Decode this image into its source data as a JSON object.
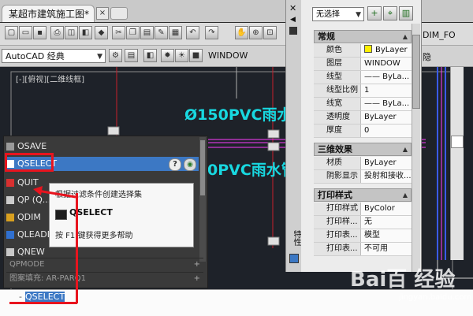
{
  "file_tab": {
    "title": "某超市建筑施工图*",
    "close": "×"
  },
  "toolbar": {
    "dim_style": "DIM_FO",
    "nav_hide": "隐"
  },
  "workspace": {
    "label": "AutoCAD 经典",
    "layer": "WINDOW"
  },
  "viewport": {
    "label": "[-][俯视][二维线框]"
  },
  "drawing_text": {
    "line1": "Ø150PVC雨水管",
    "line2": "0PVC雨水管"
  },
  "palette": {
    "selection": "无选择",
    "side_title": "特性",
    "sections": [
      {
        "title": "常规",
        "rows": [
          {
            "key": "颜色",
            "value": "ByLayer",
            "swatch": "#ffef00"
          },
          {
            "key": "图层",
            "value": "WINDOW"
          },
          {
            "key": "线型",
            "value": "—— ByLa..."
          },
          {
            "key": "线型比例",
            "value": "1"
          },
          {
            "key": "线宽",
            "value": "—— ByLa..."
          },
          {
            "key": "透明度",
            "value": "ByLayer"
          },
          {
            "key": "厚度",
            "value": "0"
          }
        ]
      },
      {
        "title": "三维效果",
        "rows": [
          {
            "key": "材质",
            "value": "ByLayer"
          },
          {
            "key": "阴影显示",
            "value": "投射和接收..."
          }
        ]
      },
      {
        "title": "打印样式",
        "rows": [
          {
            "key": "打印样式",
            "value": "ByColor"
          },
          {
            "key": "打印样...",
            "value": "无"
          },
          {
            "key": "打印表...",
            "value": "模型"
          },
          {
            "key": "打印表...",
            "value": "不可用"
          }
        ]
      }
    ]
  },
  "autocomplete": {
    "items": [
      {
        "label": "OSAVE",
        "selected": false
      },
      {
        "label": "QSELECT",
        "selected": true
      },
      {
        "label": "QUIT",
        "selected": false
      },
      {
        "label": "QP (Q...",
        "selected": false
      },
      {
        "label": "QDIM",
        "selected": false
      },
      {
        "label": "QLEADER",
        "selected": false
      },
      {
        "label": "QNEW",
        "selected": false
      }
    ],
    "categories": [
      {
        "label": "QPMODE",
        "plus": "+"
      },
      {
        "label": "图案填充: AR-PARQ1",
        "plus": "+"
      }
    ]
  },
  "tooltip": {
    "description": "根据过滤条件创建选择集",
    "command": "QSELECT",
    "help": "按 F1 键获得更多帮助"
  },
  "command_line": {
    "prompt": "-",
    "input": "QSELECT"
  },
  "watermark": {
    "main": "Bai百 经验",
    "sub": "jingyan.baidu.com"
  },
  "colors": {
    "accent": "#3c78c4",
    "annotation": "#e8141e",
    "pipe_text": "#18d8e0",
    "background": "#1e2229"
  }
}
